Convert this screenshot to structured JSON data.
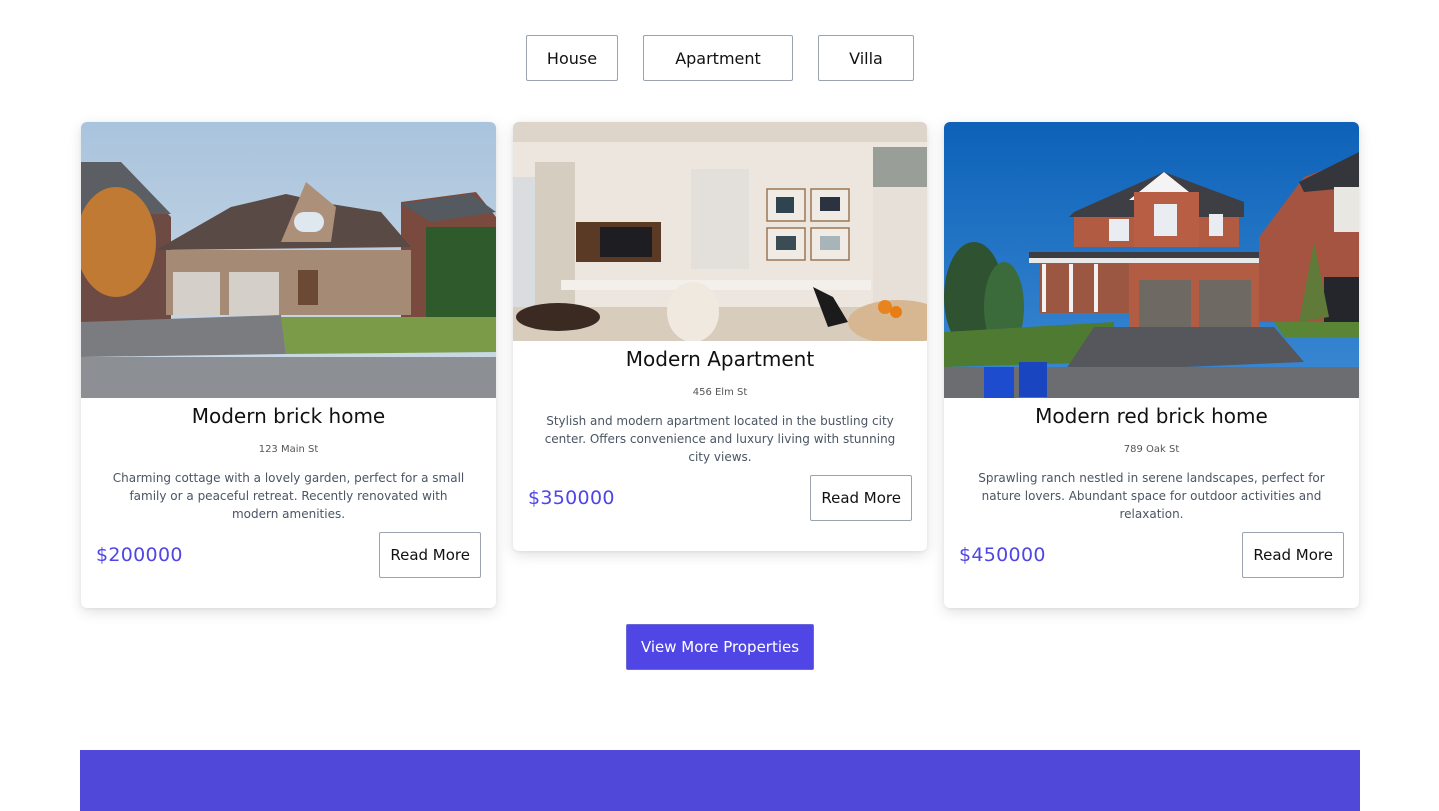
{
  "filters": [
    {
      "label": "House"
    },
    {
      "label": "Apartment"
    },
    {
      "label": "Villa"
    }
  ],
  "properties": [
    {
      "title": "Modern brick home",
      "address": "123 Main St",
      "description": "Charming cottage with a lovely garden, perfect for a small family or a peaceful retreat. Recently renovated with modern amenities.",
      "price": "$200000",
      "button": "Read More",
      "image": "photo of a beige stone two-car-garage house under blue sky with autumn tree"
    },
    {
      "title": "Modern Apartment",
      "address": "456 Elm St",
      "description": "Stylish and modern apartment located in the bustling city center. Offers convenience and luxury living with stunning city views.",
      "price": "$350000",
      "button": "Read More",
      "image": "photo of a bright modern living room with TV, framed art and white armchair"
    },
    {
      "title": "Modern red brick home",
      "address": "789 Oak St",
      "description": "Sprawling ranch nestled in serene landscapes, perfect for nature lovers. Abundant space for outdoor activities and relaxation.",
      "price": "$450000",
      "button": "Read More",
      "image": "photo of a red brick two-storey house with grey garage doors and deep blue sky"
    }
  ],
  "view_more_label": "View More Properties",
  "colors": {
    "accent": "#4f46e5",
    "footer": "#5048d9"
  }
}
